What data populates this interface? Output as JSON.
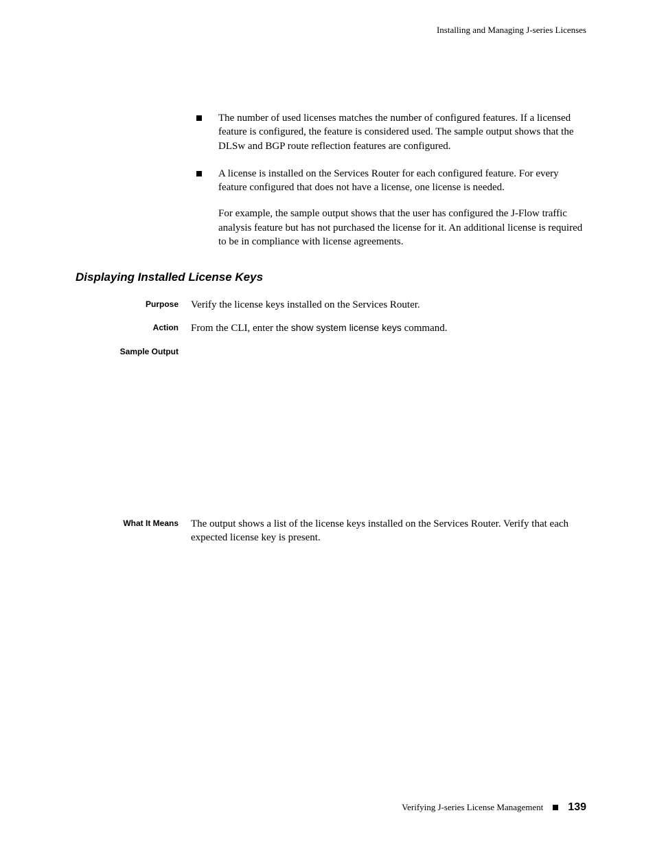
{
  "header": {
    "chapter": "Installing and Managing J-series Licenses"
  },
  "bullets": [
    {
      "text": "The number of used licenses matches the number of configured features. If a licensed feature is configured, the feature is considered used. The sample output shows that the DLSw and BGP route reflection features are configured."
    },
    {
      "text": "A license is installed on the Services Router for each configured feature. For every feature configured that does not have a license, one license is needed.",
      "para": "For example, the sample output shows that the user has configured the J-Flow traffic analysis feature but has not purchased the license for it. An additional license is required to be in compliance with license agreements."
    }
  ],
  "section": {
    "heading": "Displaying Installed License Keys",
    "purpose_label": "Purpose",
    "purpose_text": "Verify the license keys installed on the Services Router.",
    "action_label": "Action",
    "action_prefix": "From the CLI, enter the ",
    "action_command": "show system license keys",
    "action_suffix": " command.",
    "sample_output_label": "Sample Output",
    "means_label": "What It Means",
    "means_text": "The output shows a list of the license keys installed on the Services Router. Verify that each expected license key is present."
  },
  "footer": {
    "text": "Verifying J-series License Management",
    "page": "139"
  }
}
